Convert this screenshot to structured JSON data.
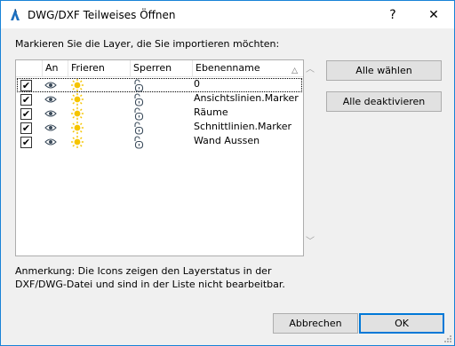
{
  "window": {
    "title": "DWG/DXF Teilweises Öffnen",
    "help_label": "?",
    "close_label": "✕"
  },
  "instruction": "Markieren Sie die Layer, die Sie importieren möchten:",
  "columns": {
    "an": "An",
    "frieren": "Frieren",
    "sperren": "Sperren",
    "ebenenname": "Ebenenname"
  },
  "layers": [
    {
      "name": "0",
      "checked": true
    },
    {
      "name": "Ansichtslinien.Marker",
      "checked": true
    },
    {
      "name": "Räume",
      "checked": true
    },
    {
      "name": "Schnittlinien.Marker",
      "checked": true
    },
    {
      "name": "Wand Aussen",
      "checked": true
    }
  ],
  "note": {
    "line1": "Anmerkung: Die Icons zeigen den Layerstatus in der",
    "line2": "DXF/DWG-Datei und sind in der Liste nicht bearbeitbar."
  },
  "buttons": {
    "select_all": "Alle wählen",
    "deselect_all": "Alle deaktivieren",
    "cancel": "Abbrechen",
    "ok": "OK"
  },
  "colors": {
    "sun": "#f5c400",
    "accent": "#0078d7",
    "icon": "#3a4a5a"
  },
  "icons": {
    "app": "archicad-logo-icon",
    "visible": "eye-icon",
    "thawed": "sun-icon",
    "unlocked": "open-lock-icon"
  }
}
